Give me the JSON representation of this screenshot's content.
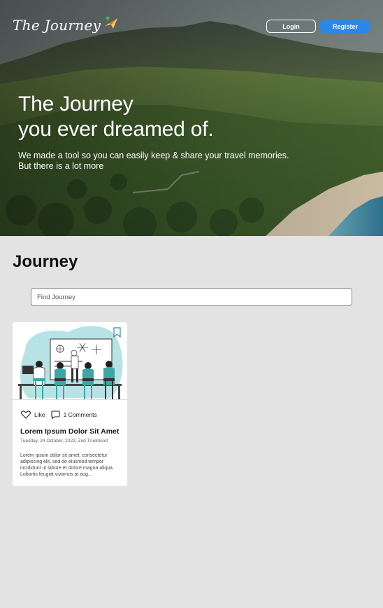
{
  "header": {
    "logo_text": "The Journey",
    "login_label": "Login",
    "register_label": "Register"
  },
  "hero": {
    "title_line1": "The Journey",
    "title_line2": "you ever dreamed of.",
    "subtitle_line1": "We made a tool so you can easily keep & share your travel memories.",
    "subtitle_line2": "But there is a lot more"
  },
  "section": {
    "title": "Journey",
    "search_placeholder": "Find Journey"
  },
  "cards": [
    {
      "like_label": "Like",
      "comments_label": "1 Comments",
      "title": "Lorem Ipsum Dolor Sit Amet",
      "date_author": "Tuesday, 24 October, 2023, Zed Trueblood",
      "excerpt": "Lorem ipsum dolor sit amet, consectetur adipiscing elit, sed do eiusmod tempor incididunt ut labore et dolore magna aliqua. Lobortis feugiat vivamus at aug..."
    }
  ],
  "colors": {
    "accent": "#2d87e6",
    "page_bg": "#e3e3e3",
    "illustration_teal": "#3aa7a5"
  },
  "icons": [
    "logo-plane-icon",
    "bookmark-icon",
    "heart-icon",
    "comment-icon"
  ]
}
